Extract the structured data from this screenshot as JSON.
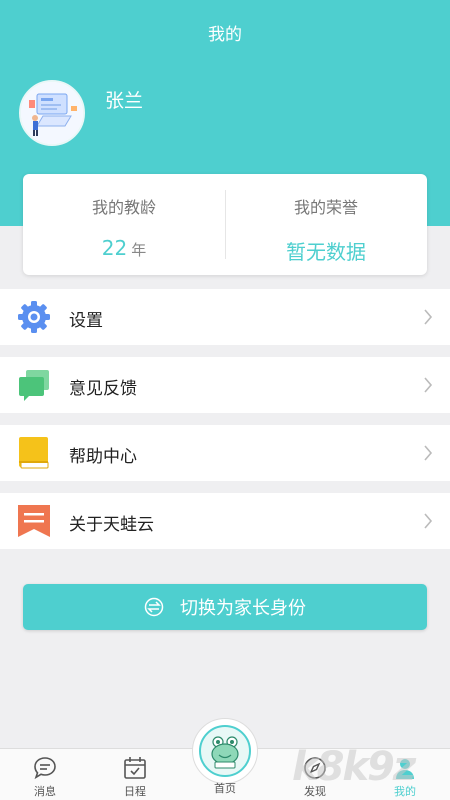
{
  "header": {
    "title": "我的"
  },
  "profile": {
    "name": "张兰"
  },
  "stats": {
    "teaching_years_label": "我的教龄",
    "teaching_years_value": "22",
    "teaching_years_unit": "年",
    "honors_label": "我的荣誉",
    "honors_value": "暂无数据"
  },
  "menu": [
    {
      "label": "设置",
      "icon": "gear-icon"
    },
    {
      "label": "意见反馈",
      "icon": "feedback-icon"
    },
    {
      "label": "帮助中心",
      "icon": "book-icon"
    },
    {
      "label": "关于天蛙云",
      "icon": "bookmark-icon"
    }
  ],
  "switch_button": {
    "label": "切换为家长身份",
    "icon": "switch-icon"
  },
  "tabbar": {
    "items": [
      {
        "label": "消息",
        "icon": "message-icon"
      },
      {
        "label": "日程",
        "icon": "calendar-icon"
      },
      {
        "label": "首页",
        "icon": "home-frog-icon"
      },
      {
        "label": "发现",
        "icon": "compass-icon"
      },
      {
        "label": "我的",
        "icon": "user-icon"
      }
    ],
    "active_index": 4
  },
  "watermark": {
    "text": "k8k9z"
  },
  "colors": {
    "accent": "#4ecfcf",
    "gear": "#5a8ff0",
    "feedback": "#4cc47a",
    "book": "#f5c21a",
    "bookmark": "#ef7650"
  }
}
